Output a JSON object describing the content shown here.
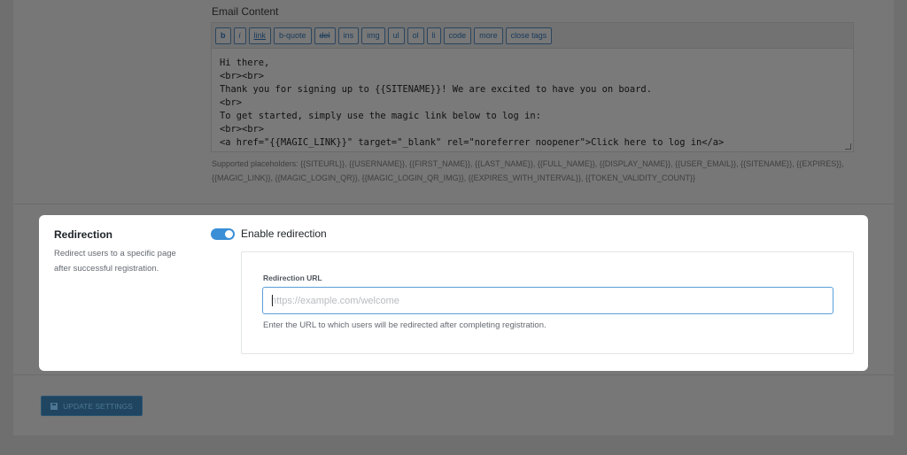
{
  "email": {
    "label": "Email Content",
    "toolbar": [
      {
        "id": "b",
        "label": "b"
      },
      {
        "id": "i",
        "label": "i"
      },
      {
        "id": "link",
        "label": "link"
      },
      {
        "id": "b-quote",
        "label": "b-quote"
      },
      {
        "id": "del",
        "label": "del"
      },
      {
        "id": "ins",
        "label": "ins"
      },
      {
        "id": "img",
        "label": "img"
      },
      {
        "id": "ul",
        "label": "ul"
      },
      {
        "id": "ol",
        "label": "ol"
      },
      {
        "id": "li",
        "label": "li"
      },
      {
        "id": "code",
        "label": "code"
      },
      {
        "id": "more",
        "label": "more"
      },
      {
        "id": "close-tags",
        "label": "close tags"
      }
    ],
    "content": "Hi there,\n<br><br>\nThank you for signing up to {{SITENAME}}! We are excited to have you on board.\n<br>\nTo get started, simply use the magic link below to log in:\n<br><br>\n<a href=\"{{MAGIC_LINK}}\" target=\"_blank\" rel=\"noreferrer noopener\">Click here to log in</a>",
    "placeholders_text": "Supported placeholders: {{SITEURL}}, {{USERNAME}}, {{FIRST_NAME}}, {{LAST_NAME}}, {{FULL_NAME}}, {{DISPLAY_NAME}}, {{USER_EMAIL}}, {{SITENAME}}, {{EXPIRES}}, {{MAGIC_LINK}}, {{MAGIC_LOGIN_QR}}, {{MAGIC_LOGIN_QR_IMG}}, {{EXPIRES_WITH_INTERVAL}}, {{TOKEN_VALIDITY_COUNT}}"
  },
  "redirection": {
    "title": "Redirection",
    "description": "Redirect users to a specific page after successful registration.",
    "toggle_label": "Enable redirection",
    "toggle_on": true,
    "url_label": "Redirection URL",
    "url_value": "",
    "url_placeholder": "https://example.com/welcome",
    "help_text": "Enter the URL to which users will be redirected after completing registration."
  },
  "actions": {
    "update_label": "UPDATE SETTINGS",
    "update_icon": "save-disk-icon"
  },
  "colors": {
    "accent": "#3a8fd6",
    "overlay": "#777777",
    "modal_bg": "#ffffff"
  }
}
